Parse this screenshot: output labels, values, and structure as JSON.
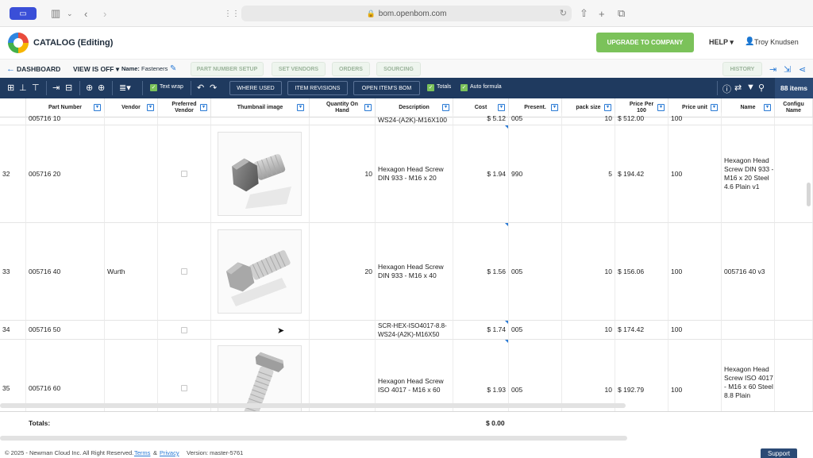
{
  "browser": {
    "url": "bom.openbom.com"
  },
  "header": {
    "title": "CATALOG (Editing)",
    "upgrade_label": "UPGRADE TO COMPANY",
    "help_label": "HELP ▾",
    "user_name": "Troy Knudsen"
  },
  "subbar": {
    "dashboard_label": "DASHBOARD",
    "view_label": "VIEW IS OFF ▾",
    "name_label": "Name:",
    "name_value": "Fasteners",
    "pills": [
      "PART NUMBER SETUP",
      "SET VENDORS",
      "ORDERS",
      "SOURCING"
    ],
    "history_label": "HISTORY"
  },
  "toolbar": {
    "text_wrap_label": "Text wrap",
    "where_used_label": "WHERE USED",
    "item_revisions_label": "ITEM REVISIONS",
    "open_items_bom_label": "OPEN ITEM'S BOM",
    "totals_label": "Totals",
    "auto_formula_label": "Auto formula",
    "items_count": "88 items"
  },
  "columns": [
    "Part Number",
    "Vendor",
    "Preferred Vendor",
    "Thumbnail image",
    "Quantity On Hand",
    "Description",
    "Cost",
    "Present.",
    "pack size",
    "Price Per 100",
    "Price unit",
    "Name",
    "Configu Name"
  ],
  "partial_row": {
    "part_number": "005716 10",
    "description": "WS24-(A2K)-M16X100",
    "cost": "$ 5.12",
    "present": "005",
    "pack_size": "10",
    "price_per_100": "$ 512.00",
    "price_unit": "100"
  },
  "rows": [
    {
      "num": "32",
      "part_number": "005716 20",
      "vendor": "",
      "qty": "10",
      "description": "Hexagon Head Screw DIN 933 - M16 x 20",
      "cost": "$ 1.94",
      "present": "990",
      "pack_size": "5",
      "price_per_100": "$ 194.42",
      "price_unit": "100",
      "name": "Hexagon Head Screw DIN 933 - M16 x 20 Steel 4.6 Plain v1"
    },
    {
      "num": "33",
      "part_number": "005716 40",
      "vendor": "Wurth",
      "qty": "20",
      "description": "Hexagon Head Screw DIN 933 - M16 x 40",
      "cost": "$ 1.56",
      "present": "005",
      "pack_size": "10",
      "price_per_100": "$ 156.06",
      "price_unit": "100",
      "name": "005716 40 v3"
    },
    {
      "num": "34",
      "part_number": "005716 50",
      "vendor": "",
      "qty": "",
      "description": "SCR-HEX-ISO4017-8.8-WS24-(A2K)-M16X50",
      "cost": "$ 1.74",
      "present": "005",
      "pack_size": "10",
      "price_per_100": "$ 174.42",
      "price_unit": "100",
      "name": ""
    },
    {
      "num": "35",
      "part_number": "005716 60",
      "vendor": "",
      "qty": "",
      "description": "Hexagon Head Screw ISO 4017 - M16 x 60",
      "cost": "$ 1.93",
      "present": "005",
      "pack_size": "10",
      "price_per_100": "$ 192.79",
      "price_unit": "100",
      "name": "Hexagon Head Screw ISO 4017 - M16 x 60 Steel 8.8 Plain"
    }
  ],
  "totals": {
    "label": "Totals:",
    "cost_total": "$ 0.00"
  },
  "footer": {
    "copyright": "© 2025 - Newman Cloud Inc. All Right Reserved.",
    "terms": "Terms",
    "amp": "&",
    "privacy": "Privacy",
    "version": "Version: master-5761",
    "support": "Support"
  },
  "colors": {
    "toolbar_bg": "#1f3a5f",
    "upgrade_green": "#7bc25a",
    "accent_blue": "#2a7ad5"
  }
}
